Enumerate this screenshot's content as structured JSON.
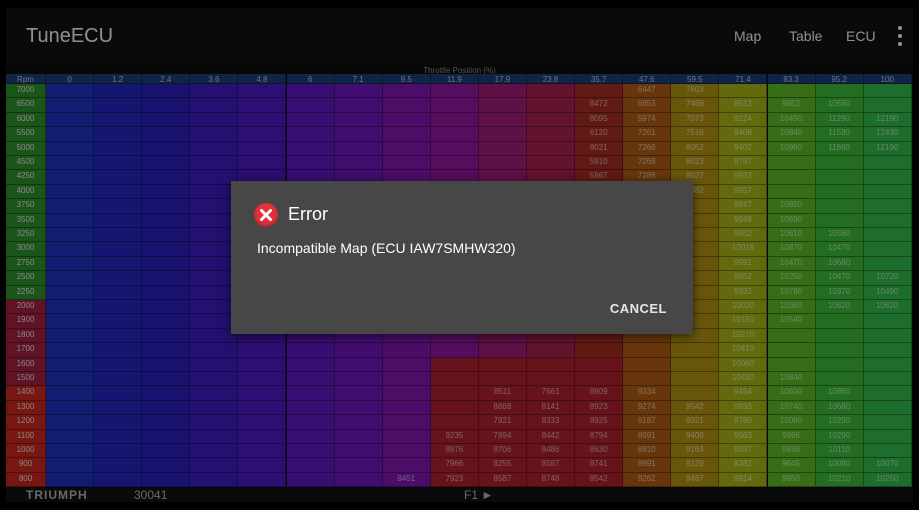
{
  "app": {
    "title": "TuneECU"
  },
  "menu": {
    "map": "Map",
    "table": "Table",
    "ecu": "ECU"
  },
  "table": {
    "axis_title": "Throttle Position (%)",
    "corner": "Rpm",
    "columns": [
      "0",
      "1.2",
      "2.4",
      "3.6",
      "4.8",
      "6",
      "7.1",
      "9.5",
      "11.9",
      "17.9",
      "23.8",
      "35.7",
      "47.6",
      "59.5",
      "71.4",
      "83.3",
      "95.2",
      "100"
    ],
    "rows": [
      "7000",
      "6500",
      "6000",
      "5500",
      "5000",
      "4500",
      "4250",
      "4000",
      "3750",
      "3500",
      "3250",
      "3000",
      "2750",
      "2500",
      "2250",
      "2000",
      "1900",
      "1800",
      "1700",
      "1600",
      "1500",
      "1400",
      "1300",
      "1200",
      "1100",
      "1000",
      "900",
      "800"
    ],
    "visible_values": [
      [
        "",
        "",
        "",
        "",
        "",
        "",
        "",
        "",
        "",
        "",
        "",
        "",
        "6447",
        "7603",
        "",
        "",
        "",
        ""
      ],
      [
        "",
        "",
        "",
        "",
        "",
        "",
        "",
        "",
        "",
        "",
        "",
        "8472",
        "6853",
        "7469",
        "8512",
        "9852",
        "10560",
        ""
      ],
      [
        "",
        "",
        "",
        "",
        "",
        "",
        "",
        "",
        "",
        "",
        "",
        "8095",
        "5974",
        "7073",
        "9224",
        "10490",
        "11290",
        "12190"
      ],
      [
        "",
        "",
        "",
        "",
        "",
        "",
        "",
        "",
        "",
        "",
        "",
        "6120",
        "7261",
        "7516",
        "9408",
        "10840",
        "11580",
        "12430"
      ],
      [
        "",
        "",
        "",
        "",
        "",
        "",
        "",
        "",
        "",
        "",
        "",
        "8021",
        "7266",
        "8052",
        "9402",
        "10960",
        "11860",
        "12190"
      ],
      [
        "",
        "",
        "",
        "",
        "",
        "",
        "",
        "",
        "",
        "",
        "",
        "5910",
        "7268",
        "8023",
        "8757",
        "",
        "",
        ""
      ],
      [
        "",
        "",
        "",
        "",
        "",
        "",
        "",
        "",
        "",
        "",
        "",
        "5867",
        "7288",
        "8027",
        "9933",
        "",
        "",
        ""
      ],
      [
        "",
        "",
        "",
        "",
        "",
        "",
        "",
        "",
        "",
        "",
        "",
        "",
        "",
        "8382",
        "9957",
        "",
        "",
        ""
      ],
      [
        "",
        "",
        "",
        "",
        "",
        "",
        "",
        "",
        "",
        "",
        "",
        "",
        "",
        "",
        "9947",
        "10850",
        "",
        ""
      ],
      [
        "",
        "",
        "",
        "",
        "",
        "",
        "",
        "",
        "",
        "",
        "",
        "",
        "",
        "",
        "9948",
        "10690",
        "",
        ""
      ],
      [
        "",
        "",
        "",
        "",
        "",
        "",
        "",
        "",
        "",
        "",
        "",
        "",
        "",
        "",
        "9952",
        "10610",
        "10560",
        ""
      ],
      [
        "",
        "",
        "",
        "",
        "",
        "",
        "",
        "",
        "",
        "",
        "",
        "",
        "",
        "",
        "10018",
        "10870",
        "10470",
        ""
      ],
      [
        "",
        "",
        "",
        "",
        "",
        "",
        "",
        "",
        "",
        "",
        "",
        "",
        "",
        "",
        "9991",
        "10470",
        "10680",
        ""
      ],
      [
        "",
        "",
        "",
        "",
        "",
        "",
        "",
        "",
        "",
        "",
        "",
        "",
        "",
        "",
        "9852",
        "10250",
        "10470",
        "10720"
      ],
      [
        "",
        "",
        "",
        "",
        "",
        "",
        "",
        "",
        "",
        "",
        "",
        "",
        "",
        "",
        "9932",
        "10780",
        "10370",
        "10490"
      ],
      [
        "",
        "",
        "",
        "",
        "",
        "",
        "",
        "",
        "",
        "",
        "",
        "",
        "",
        "",
        "10020",
        "10360",
        "10620",
        "10620"
      ],
      [
        "",
        "",
        "",
        "",
        "",
        "",
        "",
        "",
        "",
        "",
        "",
        "",
        "",
        "",
        "10150",
        "10540",
        "",
        ""
      ],
      [
        "",
        "",
        "",
        "",
        "",
        "",
        "",
        "",
        "",
        "",
        "",
        "",
        "",
        "",
        "10270",
        "",
        "",
        ""
      ],
      [
        "",
        "",
        "",
        "",
        "",
        "",
        "",
        "",
        "",
        "",
        "",
        "",
        "",
        "",
        "10410",
        "",
        "",
        ""
      ],
      [
        "",
        "",
        "",
        "",
        "",
        "",
        "",
        "",
        "",
        "",
        "",
        "",
        "",
        "",
        "10060",
        "",
        "",
        ""
      ],
      [
        "",
        "",
        "",
        "",
        "",
        "",
        "",
        "",
        "",
        "",
        "",
        "",
        "",
        "",
        "10430",
        "10840",
        "",
        ""
      ],
      [
        "",
        "",
        "",
        "",
        "",
        "",
        "",
        "",
        "",
        "8511",
        "7661",
        "8909",
        "9334",
        "",
        "9454",
        "10600",
        "10860",
        ""
      ],
      [
        "",
        "",
        "",
        "",
        "",
        "",
        "",
        "",
        "",
        "8868",
        "8141",
        "8923",
        "9274",
        "9542",
        "9833",
        "10740",
        "10680",
        ""
      ],
      [
        "",
        "",
        "",
        "",
        "",
        "",
        "",
        "",
        "",
        "7921",
        "8333",
        "8925",
        "9187",
        "9321",
        "9780",
        "10080",
        "10290",
        ""
      ],
      [
        "",
        "",
        "",
        "",
        "",
        "",
        "",
        "",
        "9235",
        "7894",
        "8442",
        "8794",
        "8991",
        "9408",
        "9563",
        "9996",
        "10290",
        ""
      ],
      [
        "",
        "",
        "",
        "",
        "",
        "",
        "",
        "",
        "8976",
        "8706",
        "8486",
        "8630",
        "8810",
        "9164",
        "8557",
        "9838",
        "10110",
        ""
      ],
      [
        "",
        "",
        "",
        "",
        "",
        "",
        "",
        "",
        "7966",
        "8255",
        "8587",
        "8741",
        "8991",
        "9129",
        "8382",
        "9645",
        "10080",
        "10070"
      ],
      [
        "",
        "",
        "",
        "",
        "",
        "",
        "",
        "9451",
        "7923",
        "8587",
        "8748",
        "8542",
        "9262",
        "9467",
        "9914",
        "9850",
        "10210",
        "10250"
      ]
    ]
  },
  "status": {
    "brand": "TRIUMPH",
    "ecu_id": "30041",
    "key": "F1 ►"
  },
  "dialog": {
    "title": "Error",
    "message": "Incompatible Map (ECU IAW7SMHW320)",
    "cancel": "CANCEL"
  },
  "colors": {
    "error_red": "#e3313a",
    "dialog_bg": "#474747",
    "actionbar_bg": "#111111",
    "header_row": "#1b3a73"
  },
  "icons": {
    "error": "error-icon",
    "overflow": "more-vert-icon"
  }
}
